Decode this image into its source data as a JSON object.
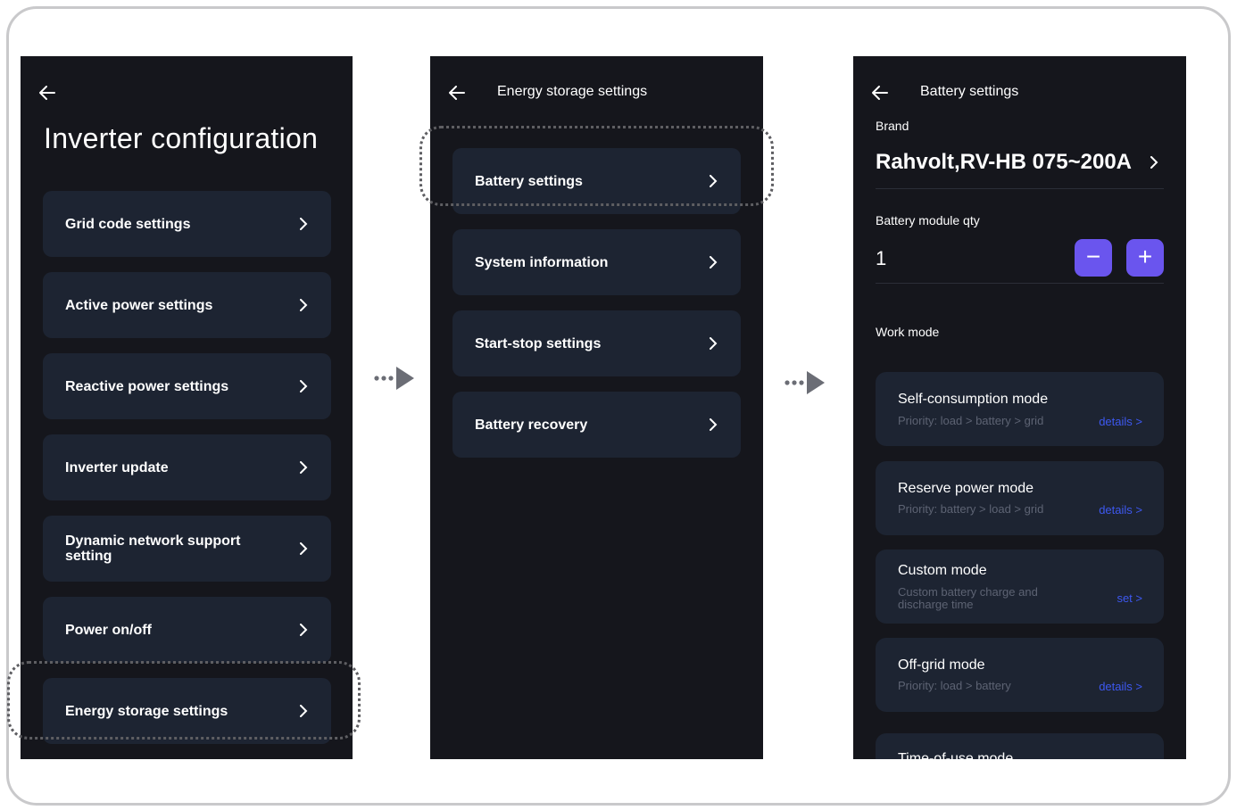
{
  "screen1": {
    "title": "Inverter configuration",
    "items": [
      {
        "label": "Grid code settings"
      },
      {
        "label": "Active power settings"
      },
      {
        "label": "Reactive power settings"
      },
      {
        "label": "Inverter update"
      },
      {
        "label": "Dynamic network support setting"
      },
      {
        "label": "Power on/off"
      },
      {
        "label": "Energy storage settings"
      }
    ]
  },
  "screen2": {
    "title": "Energy storage settings",
    "items": [
      {
        "label": "Battery settings"
      },
      {
        "label": "System information"
      },
      {
        "label": "Start-stop settings"
      },
      {
        "label": "Battery recovery"
      }
    ]
  },
  "screen3": {
    "title": "Battery settings",
    "brand_label": "Brand",
    "brand_value": "Rahvolt,RV-HB 075~200A",
    "qty_label": "Battery module qty",
    "qty_value": "1",
    "minus": "−",
    "plus": "+",
    "work_mode_label": "Work mode",
    "modes": [
      {
        "title": "Self-consumption mode",
        "desc": "Priority: load > battery > grid",
        "link": "details >"
      },
      {
        "title": "Reserve power mode",
        "desc": "Priority: battery > load > grid",
        "link": "details >"
      },
      {
        "title": "Custom mode",
        "desc": "Custom battery charge and discharge time",
        "link": "set >"
      },
      {
        "title": "Off-grid mode",
        "desc": "Priority: load > battery",
        "link": "details >"
      },
      {
        "title": "Time-of-use mode",
        "desc": "",
        "link": ""
      }
    ]
  },
  "colors": {
    "screen_bg": "#15161c",
    "card_bg": "#1d2432",
    "accent_button": "#6a55ee",
    "link": "#3d58f0",
    "muted_text": "#5d6373"
  }
}
